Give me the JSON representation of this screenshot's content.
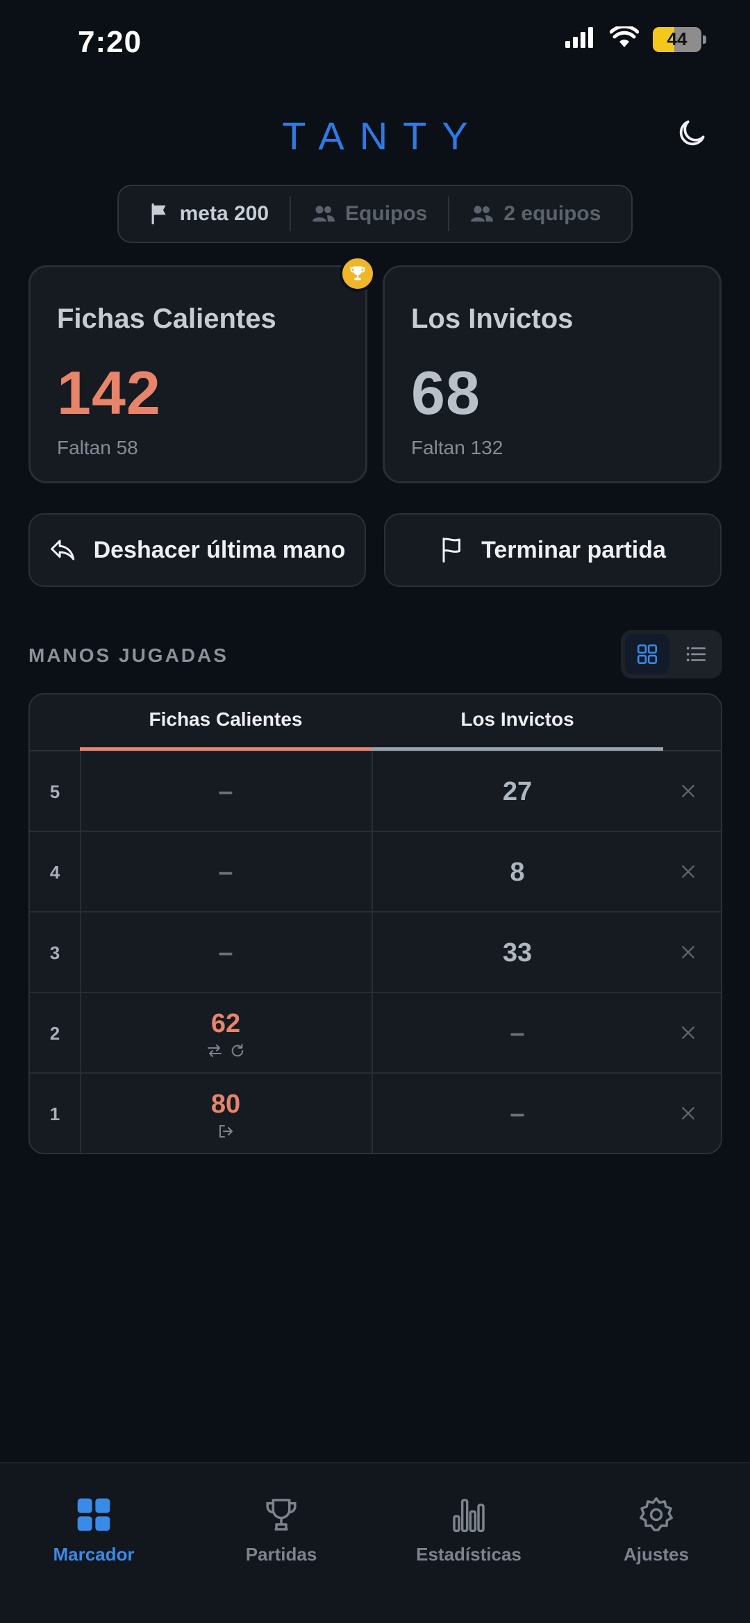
{
  "status_bar": {
    "time": "7:20",
    "battery": "44"
  },
  "header": {
    "logo": "TANTY"
  },
  "settings_pills": [
    {
      "label": "meta 200",
      "icon": "flag-icon",
      "active": true
    },
    {
      "label": "Equipos",
      "icon": "people-icon",
      "active": false
    },
    {
      "label": "2 equipos",
      "icon": "people-icon",
      "active": false
    }
  ],
  "teams": [
    {
      "name": "Fichas Calientes",
      "score": "142",
      "remaining": "Faltan 58",
      "leader": true
    },
    {
      "name": "Los Invictos",
      "score": "68",
      "remaining": "Faltan 132",
      "leader": false
    }
  ],
  "actions": {
    "undo_label": "Deshacer última mano",
    "finish_label": "Terminar partida"
  },
  "hands_section": {
    "title": "MANOS JUGADAS",
    "columns": [
      "Fichas Calientes",
      "Los Invictos"
    ],
    "rows": [
      {
        "number": "5",
        "team1": "–",
        "team2": "27"
      },
      {
        "number": "4",
        "team1": "–",
        "team2": "8"
      },
      {
        "number": "3",
        "team1": "–",
        "team2": "33"
      },
      {
        "number": "2",
        "team1": "62",
        "team2": "–",
        "icons": [
          "swap-icon",
          "refresh-icon"
        ]
      },
      {
        "number": "1",
        "team1": "80",
        "team2": "–",
        "icons": [
          "exit-icon"
        ]
      }
    ]
  },
  "tab_bar": [
    {
      "label": "Marcador",
      "icon": "grid-icon",
      "active": true
    },
    {
      "label": "Partidas",
      "icon": "trophy-icon",
      "active": false
    },
    {
      "label": "Estadísticas",
      "icon": "bar-chart-icon",
      "active": false
    },
    {
      "label": "Ajustes",
      "icon": "gear-icon",
      "active": false
    }
  ],
  "colors": {
    "accent": "#2e7ae6",
    "team1": "#e8846a",
    "team2": "#aeb6bf",
    "background": "#0b0f16"
  }
}
